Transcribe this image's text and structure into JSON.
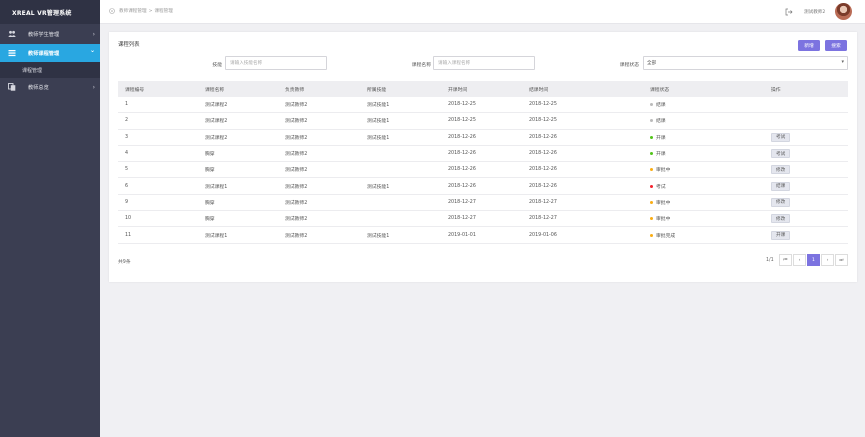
{
  "app": {
    "title": "XREAL VR管理系统"
  },
  "sidebar": {
    "items": [
      {
        "label": "教师学生管理",
        "icon": "users-icon",
        "arrow": "›"
      },
      {
        "label": "教师课程管理",
        "icon": "list-icon",
        "arrow": "⌄",
        "active": true
      },
      {
        "label": "教师总览",
        "icon": "copy-icon",
        "arrow": "›"
      }
    ],
    "subitems": [
      {
        "label": "课程管理"
      }
    ]
  },
  "header": {
    "breadcrumb": [
      "教师课程管理",
      "课程管理"
    ],
    "breadcrumb_sep": ">",
    "username": "测试教师2"
  },
  "panel": {
    "title": "课程列表",
    "buttons": {
      "add": "新增",
      "search": "搜索"
    },
    "filters": {
      "skill_label": "技能",
      "skill_placeholder": "请输入技能名称",
      "course_label": "课程名称",
      "course_placeholder": "请输入课程名称",
      "status_label": "课程状态",
      "status_value": "全部"
    }
  },
  "table": {
    "headers": [
      "课程编号",
      "课程名称",
      "负责教师",
      "所属技能",
      "开课时间",
      "结课时间",
      "课程状态",
      "操作"
    ],
    "rows": [
      {
        "id": "1",
        "name": "测试课程2",
        "teacher": "测试教师2",
        "skill": "测试技能1",
        "start": "2018-12-25",
        "end": "2018-12-25",
        "status": "结课",
        "status_color": "#bbbbbb",
        "action": ""
      },
      {
        "id": "2",
        "name": "测试课程2",
        "teacher": "测试教师2",
        "skill": "测试技能1",
        "start": "2018-12-25",
        "end": "2018-12-25",
        "status": "结课",
        "status_color": "#bbbbbb",
        "action": ""
      },
      {
        "id": "3",
        "name": "测试课程2",
        "teacher": "测试教师2",
        "skill": "测试技能1",
        "start": "2018-12-26",
        "end": "2018-12-26",
        "status": "开课",
        "status_color": "#52c41a",
        "action": "考试"
      },
      {
        "id": "4",
        "name": "胸穿",
        "teacher": "测试教师2",
        "skill": "",
        "start": "2018-12-26",
        "end": "2018-12-26",
        "status": "开课",
        "status_color": "#52c41a",
        "action": "考试"
      },
      {
        "id": "5",
        "name": "胸穿",
        "teacher": "测试教师2",
        "skill": "",
        "start": "2018-12-26",
        "end": "2018-12-26",
        "status": "审批中",
        "status_color": "#faad14",
        "action": "修改"
      },
      {
        "id": "6",
        "name": "测试课程1",
        "teacher": "测试教师2",
        "skill": "测试技能1",
        "start": "2018-12-26",
        "end": "2018-12-26",
        "status": "考试",
        "status_color": "#f5222d",
        "action": "结课"
      },
      {
        "id": "9",
        "name": "胸穿",
        "teacher": "测试教师2",
        "skill": "",
        "start": "2018-12-27",
        "end": "2018-12-27",
        "status": "审批中",
        "status_color": "#faad14",
        "action": "修改"
      },
      {
        "id": "10",
        "name": "胸穿",
        "teacher": "测试教师2",
        "skill": "",
        "start": "2018-12-27",
        "end": "2018-12-27",
        "status": "审批中",
        "status_color": "#faad14",
        "action": "修改"
      },
      {
        "id": "11",
        "name": "测试课程1",
        "teacher": "测试教师2",
        "skill": "测试技能1",
        "start": "2019-01-01",
        "end": "2019-01-06",
        "status": "审批完成",
        "status_color": "#faad14",
        "action": "开课"
      }
    ]
  },
  "footer": {
    "total": "共9条",
    "page_info": "1/1",
    "pages": {
      "first": "⏮",
      "prev": "‹",
      "current": "1",
      "next": "›",
      "last": "⏭"
    }
  }
}
